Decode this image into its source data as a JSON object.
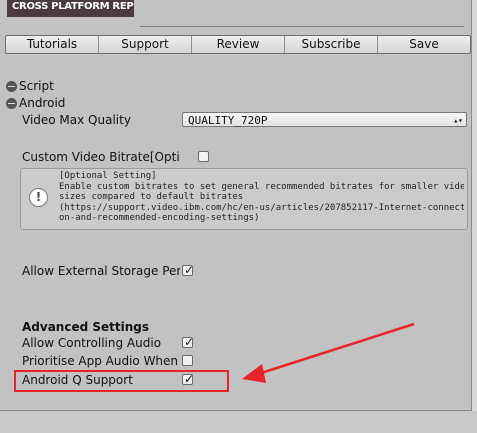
{
  "banner": {
    "title": "CROSS PLATFORM REPLAY KIT"
  },
  "toolbar": {
    "buttons": [
      {
        "label": "Tutorials"
      },
      {
        "label": "Support"
      },
      {
        "label": "Review"
      },
      {
        "label": "Subscribe"
      },
      {
        "label": "Save"
      }
    ]
  },
  "sections": {
    "script": "Script",
    "android": "Android"
  },
  "fields": {
    "video_max_quality_label": "Video Max Quality",
    "video_max_quality_value": "QUALITY_720P",
    "custom_bitrate_label": "Custom Video Bitrate[Optic",
    "custom_bitrate_checked": false,
    "external_storage_label": "Allow External Storage Perr",
    "external_storage_checked": true
  },
  "help": {
    "lines": [
      "[Optional Setting]",
      "Enable custom bitrates to set general recommended bitrates for smaller video",
      "sizes compared to default bitrates",
      "(https://support.video.ibm.com/hc/en-us/articles/207852117-Internet-connecti",
      "on-and-recommended-encoding-settings)"
    ]
  },
  "advanced": {
    "heading": "Advanced Settings",
    "allow_controlling_audio_label": "Allow Controlling Audio",
    "allow_controlling_audio_checked": true,
    "prioritise_app_audio_label": "Prioritise App Audio When U",
    "prioritise_app_audio_checked": false,
    "android_q_support_label": "Android Q Support",
    "android_q_support_checked": true
  },
  "annotation_color": "#e8232a"
}
